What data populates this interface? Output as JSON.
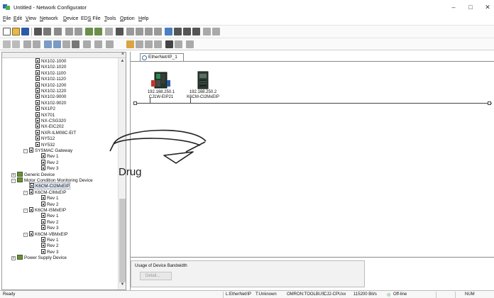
{
  "window": {
    "title": "Untitled - Network Configurator"
  },
  "menu": [
    "File",
    "Edit",
    "View",
    "Network",
    "Device",
    "EDS File",
    "Tools",
    "Option",
    "Help"
  ],
  "menu_hotkeys": [
    "F",
    "E",
    "V",
    "N",
    "D",
    "S",
    "T",
    "O",
    "H"
  ],
  "tree": {
    "items": [
      "NX102-1000",
      "NX102-1020",
      "NX102-1100",
      "NX102-1120",
      "NX102-1200",
      "NX102-1220",
      "NX102-9000",
      "NX102-9020",
      "NX1P2",
      "NX701",
      "NX-CSG320",
      "NX-EIC202",
      "NXR-ILM08C-EIT",
      "NY512",
      "NY532",
      "SYSMAC Gateway",
      "Rev 1",
      "Rev 2",
      "Rev 3",
      "Generic Device",
      "Motor Condition Monitoring Device",
      "K6CM-CI2MxEIP",
      "K6CM-CIMxEIP",
      "Rev 1",
      "Rev 2",
      "K6CM-ISMxEIP",
      "Rev 1",
      "Rev 2",
      "Rev 3",
      "K6CM-VBMxEIP",
      "Rev 1",
      "Rev 2",
      "Rev 3",
      "Power Supply Device"
    ],
    "selected_index": 21
  },
  "network": {
    "tab_label": "EtherNet/IP_1",
    "nodes": [
      {
        "address": "192.168.250.1",
        "model": "CJ1W-EIP21"
      },
      {
        "address": "192.168.250.2",
        "model": "K6CM-CI2MxEIP"
      }
    ]
  },
  "bandwidth": {
    "label": "Usage of Device Bandwidth",
    "detail_button": "Detail..."
  },
  "annotation": {
    "text": "Drug"
  },
  "status": {
    "ready": "Ready",
    "network": "L:EtherNet/IP",
    "target": "T:Unknown",
    "connection": "OMRON:TOOLBUS",
    "cpu": "CJ2-CPUxx",
    "baud": "115200 Bit/s",
    "mode": "Off-line",
    "num": "NUM"
  },
  "colors": {
    "accent": "#2b5aa6",
    "plc_green": "#2f8a4d",
    "status_ok": "#3a9a3a"
  }
}
